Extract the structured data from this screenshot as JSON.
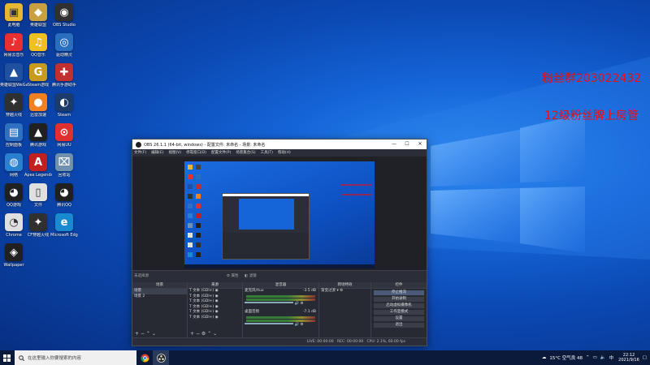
{
  "desktop": {
    "icons": [
      {
        "label": "此电脑",
        "color": "#e8b732",
        "glyph": "▣"
      },
      {
        "label": "英雄联盟",
        "color": "#c8a040",
        "glyph": "◆"
      },
      {
        "label": "OBS Studio",
        "color": "#303030",
        "glyph": "◉"
      },
      {
        "label": "网易云音乐",
        "color": "#e83030",
        "glyph": "♪"
      },
      {
        "label": "QQ音乐",
        "color": "#f0c020",
        "glyph": "♫"
      },
      {
        "label": "驱动精灵",
        "color": "#2a6ec0",
        "glyph": "◎"
      },
      {
        "label": "英雄联盟WeGame",
        "color": "#2050a0",
        "glyph": "▲"
      },
      {
        "label": "Steam游戏",
        "color": "#c89a20",
        "glyph": "G"
      },
      {
        "label": "腾讯手游助手",
        "color": "#c03030",
        "glyph": "✚"
      },
      {
        "label": "穿越火线",
        "color": "#303030",
        "glyph": "✦"
      },
      {
        "label": "迅雷加速",
        "color": "#f08020",
        "glyph": "●"
      },
      {
        "label": "Steam",
        "color": "#1b3b6a",
        "glyph": "◐"
      },
      {
        "label": "控制面板",
        "color": "#3070c0",
        "glyph": "▤"
      },
      {
        "label": "腾讯游戏",
        "color": "#202020",
        "glyph": "▲"
      },
      {
        "label": "网易UU",
        "color": "#e03030",
        "glyph": "⊙"
      },
      {
        "label": "网络",
        "color": "#2a80d0",
        "glyph": "◍"
      },
      {
        "label": "Apex Legends",
        "color": "#c02020",
        "glyph": "A"
      },
      {
        "label": "回收站",
        "color": "#7090b0",
        "glyph": "⌧"
      },
      {
        "label": "QQ游戏",
        "color": "#202020",
        "glyph": "◕"
      },
      {
        "label": "文件",
        "color": "#e0e0e0",
        "glyph": "▯"
      },
      {
        "label": "腾讯QQ",
        "color": "#202020",
        "glyph": "◕"
      },
      {
        "label": "Chrome",
        "color": "#e0e0e0",
        "glyph": "◔"
      },
      {
        "label": "CF穿越火线",
        "color": "#303030",
        "glyph": "✦"
      },
      {
        "label": "Microsoft Edge",
        "color": "#1a8ad0",
        "glyph": "e"
      },
      {
        "label": "Wallpaper",
        "color": "#202020",
        "glyph": "◈"
      }
    ],
    "overlay_line1": "粉丝群203022432",
    "overlay_line2": "12级粉丝牌上房管"
  },
  "obs": {
    "title": "OBS 26.1.1 (64-bit, windows) - 配置文件: 未命名 - 场景: 未命名",
    "menu": [
      "文件(F)",
      "编辑(E)",
      "视图(V)",
      "停靠窗口(D)",
      "配置文件(P)",
      "场景集合(S)",
      "工具(T)",
      "帮助(H)"
    ],
    "window_buttons": {
      "minimize": "—",
      "maximize": "☐",
      "close": "✕"
    },
    "no_source_selected": "未选择源",
    "properties_label": "属性",
    "filters_label": "滤镜",
    "panels": {
      "scenes": {
        "title": "场景",
        "items": [
          "场景",
          "场景 2"
        ]
      },
      "sources": {
        "title": "来源",
        "items": [
          "文本 (GDI+)",
          "文本 (GDI+)",
          "文本 (GDI+)",
          "文本 (GDI+)",
          "文本 (GDI+)",
          "文本 (GDI+)"
        ]
      },
      "mixer": {
        "title": "混音器",
        "channels": [
          {
            "name": "麦克风/Aux",
            "level": "-3.5 dB"
          },
          {
            "name": "桌面音频",
            "level": "-7.1 dB"
          }
        ]
      },
      "transitions": {
        "title": "转场特效",
        "selected": "渐变过渡"
      },
      "controls": {
        "title": "控件",
        "buttons": [
          "停止推流",
          "开始录制",
          "启动虚拟摄像机",
          "工作室模式",
          "设置",
          "退出"
        ]
      }
    },
    "status": "LIVE: 00:00:00   REC: 00:00:00   CPU: 2.1%, 60.00 fps"
  },
  "taskbar": {
    "search_placeholder": "在这里输入你要搜索的内容",
    "weather": "15°C 空气良 48",
    "ime": "中",
    "time": "22:12",
    "date": "2021/9/16"
  }
}
